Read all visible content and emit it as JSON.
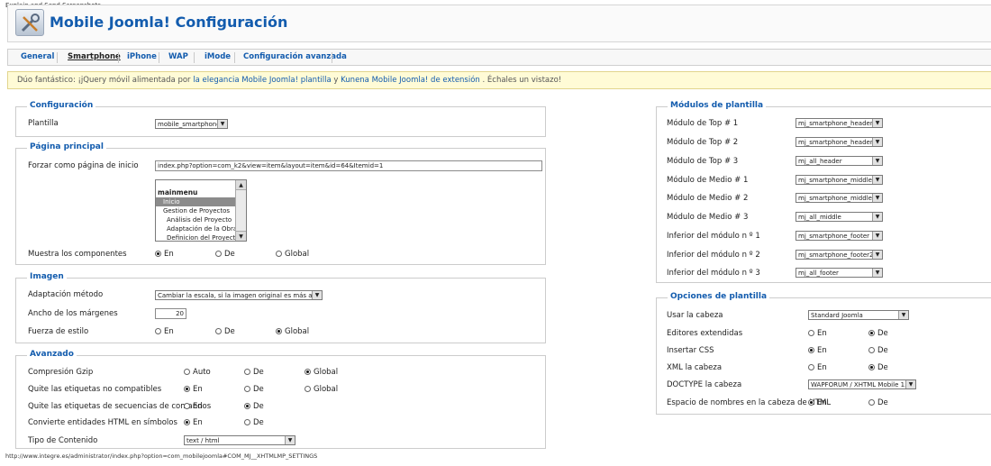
{
  "caption": "Explain and Send Screenshots",
  "header": {
    "title": "Mobile Joomla! Configuración"
  },
  "tabs": [
    {
      "label": "General"
    },
    {
      "label": "Smartphone"
    },
    {
      "label": "iPhone"
    },
    {
      "label": "WAP"
    },
    {
      "label": "iMode"
    },
    {
      "label": "Configuración avanzada"
    }
  ],
  "notice": {
    "prefix": "Dúo fantástico: ¡jQuery móvil alimentada por ",
    "link1": "la elegancia Mobile Joomla! plantilla",
    "mid": " y ",
    "link2": "Kunena Mobile Joomla! de extensión",
    "suffix": " . Échales un vistazo!"
  },
  "configuracion": {
    "legend": "Configuración",
    "plantilla_label": "Plantilla",
    "plantilla_value": "mobile_smartphone"
  },
  "pagina": {
    "legend": "Página principal",
    "forzar_label": "Forzar como página de inicio",
    "forzar_value": "index.php?option=com_k2&view=item&layout=item&id=64&Itemid=1",
    "menu_items": [
      "mainmenu",
      "Inicio",
      "Gestion de Proyectos",
      "Análisis del Proyecto",
      "Adaptación de la Obra",
      "Definicion del Proyecto"
    ],
    "muestra_label": "Muestra los componentes",
    "opt_en": "En",
    "opt_de": "De",
    "opt_global": "Global"
  },
  "imagen": {
    "legend": "Imagen",
    "adaptacion_label": "Adaptación método",
    "adaptacion_value": "Cambiar la escala, si la imagen original es más ancha",
    "ancho_label": "Ancho de los márgenes",
    "ancho_value": "20",
    "fuerza_label": "Fuerza de estilo"
  },
  "avanzado": {
    "legend": "Avanzado",
    "gzip_label": "Compresión Gzip",
    "opt_auto": "Auto",
    "quite_label": "Quite las etiquetas no compatibles",
    "secuencias_label": "Quite las etiquetas de secuencias de comandos",
    "convierte_label": "Convierte entidades HTML en símbolos",
    "tipo_label": "Tipo de Contenido",
    "tipo_value": "text / html"
  },
  "modulos": {
    "legend": "Módulos de plantilla",
    "rows": [
      {
        "label": "Módulo de Top # 1",
        "value": "mj_smartphone_header"
      },
      {
        "label": "Módulo de Top # 2",
        "value": "mj_smartphone_header2"
      },
      {
        "label": "Módulo de Top # 3",
        "value": "mj_all_header"
      },
      {
        "label": "Módulo de Medio # 1",
        "value": "mj_smartphone_middle"
      },
      {
        "label": "Módulo de Medio # 2",
        "value": "mj_smartphone_middle2"
      },
      {
        "label": "Módulo de Medio # 3",
        "value": "mj_all_middle"
      },
      {
        "label": "Inferior del módulo n º 1",
        "value": "mj_smartphone_footer"
      },
      {
        "label": "Inferior del módulo n º 2",
        "value": "mj_smartphone_footer2"
      },
      {
        "label": "Inferior del módulo n º 3",
        "value": "mj_all_footer"
      }
    ]
  },
  "opciones": {
    "legend": "Opciones de plantilla",
    "cabeza_label": "Usar la cabeza",
    "cabeza_value": "Standard Joomla",
    "editores_label": "Editores extendidas",
    "css_label": "Insertar CSS",
    "xml_label": "XML la cabeza",
    "doctype_label": "DOCTYPE la cabeza",
    "doctype_value": "WAPFORUM / XHTML Mobile 1.0",
    "espacio_label": "Espacio de nombres en la cabeza de HTML"
  },
  "status_bar": "http://www.integre.es/administrator/index.php?option=com_mobilejoomla#COM_MJ__XHTMLMP_SETTINGS"
}
